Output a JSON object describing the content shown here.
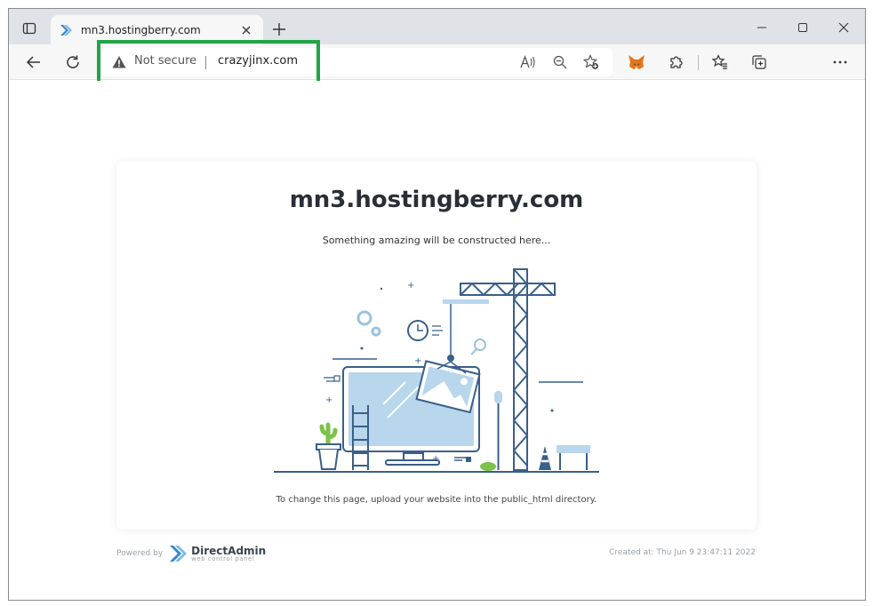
{
  "browser": {
    "tab": {
      "title": "mn3.hostingberry.com"
    },
    "address": {
      "security_label": "Not secure",
      "url": "crazyjinx.com"
    }
  },
  "page": {
    "title": "mn3.hostingberry.com",
    "subtitle": "Something amazing will be constructed here...",
    "instruction": "To change this page, upload your website into the public_html directory.",
    "footer": {
      "powered_label": "Powered by",
      "brand_name": "DirectAdmin",
      "brand_tagline": "web control panel",
      "created": "Created at: Thu Jun 9 23:47:11 2022"
    }
  },
  "colors": {
    "highlight": "#22a447",
    "illustration_blue": "#3a5f8a",
    "illustration_light": "#b8d6ec"
  }
}
